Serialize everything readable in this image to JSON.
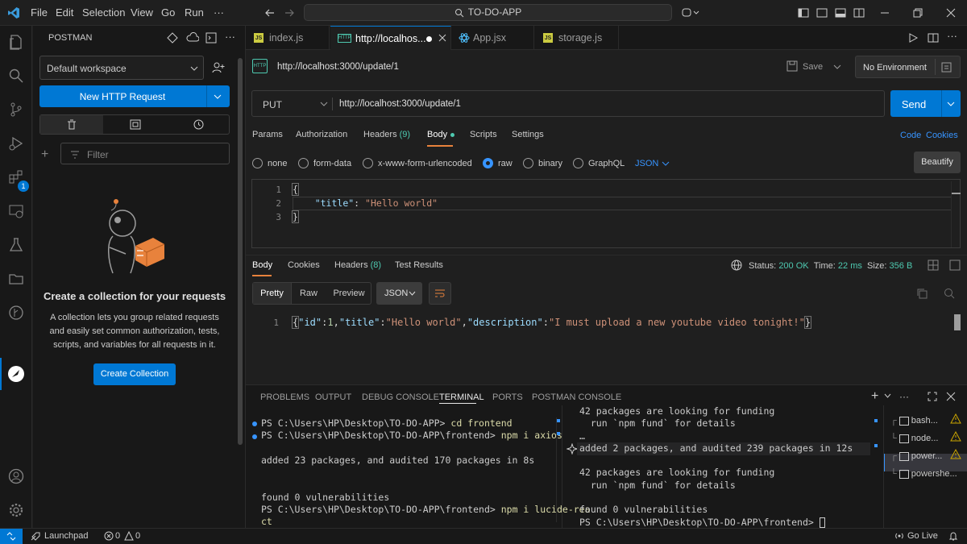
{
  "menu": [
    "File",
    "Edit",
    "Selection",
    "View",
    "Go",
    "Run",
    "···"
  ],
  "search": {
    "label": "TO-DO-APP"
  },
  "sidebar": {
    "title": "POSTMAN",
    "workspace": "Default workspace",
    "new_request": "New HTTP Request",
    "filter_placeholder": "Filter",
    "empty_title": "Create a collection for your requests",
    "empty_desc_1": "A collection lets you group related requests",
    "empty_desc_2": "and easily set common authorization, tests,",
    "empty_desc_3": "scripts, and variables for all requests in it.",
    "create_btn": "Create Collection"
  },
  "tabs": [
    {
      "label": "index.js"
    },
    {
      "label": "http://localhos..."
    },
    {
      "label": "App.jsx"
    },
    {
      "label": "storage.js"
    }
  ],
  "request": {
    "title": "http://localhost:3000/update/1",
    "save": "Save",
    "environment": "No Environment",
    "method": "PUT",
    "url": "http://localhost:3000/update/1",
    "send": "Send",
    "tabs": {
      "params": "Params",
      "authorization": "Authorization",
      "headers": "Headers",
      "headers_count": "(9)",
      "body": "Body",
      "scripts": "Scripts",
      "settings": "Settings"
    },
    "code": "Code",
    "cookies": "Cookies",
    "body_types": {
      "none": "none",
      "form_data": "form-data",
      "urlencoded": "x-www-form-urlencoded",
      "raw": "raw",
      "binary": "binary",
      "graphql": "GraphQL",
      "json": "JSON"
    },
    "beautify": "Beautify",
    "editor": {
      "ln1": "1",
      "ln2": "2",
      "ln3": "3",
      "open": "{",
      "key": "\"title\"",
      "colon": ":",
      "value": "\"Hello world\"",
      "close": "}"
    }
  },
  "response": {
    "tabs": {
      "body": "Body",
      "cookies": "Cookies",
      "headers": "Headers",
      "headers_count": "(8)",
      "test_results": "Test Results"
    },
    "status_label": "Status:",
    "status_value": "200 OK",
    "time_label": "Time:",
    "time_value": "22 ms",
    "size_label": "Size:",
    "size_value": "356 B",
    "views": {
      "pretty": "Pretty",
      "raw": "Raw",
      "preview": "Preview",
      "json": "JSON"
    },
    "ln1": "1",
    "body": {
      "p1": "{",
      "k1": "\"id\"",
      "p2": ":",
      "v1": "1",
      "p3": ",",
      "k2": "\"title\"",
      "p4": ":",
      "v2": "\"Hello world\"",
      "p5": ",",
      "k3": "\"description\"",
      "p6": ":",
      "v3": "\"I must upload a new youtube video tonight!\"",
      "p7": "}"
    }
  },
  "panel": {
    "tabs": [
      "PROBLEMS",
      "OUTPUT",
      "DEBUG CONSOLE",
      "TERMINAL",
      "PORTS",
      "POSTMAN CONSOLE"
    ],
    "left": {
      "l1_prompt": "PS C:\\Users\\HP\\Desktop\\TO-DO-APP>",
      "l1_cmd": "cd frontend",
      "l2_prompt": "PS C:\\Users\\HP\\Desktop\\TO-DO-APP\\frontend>",
      "l2_cmd": "npm i axios",
      "l3": "added 23 packages, and audited 170 packages in 8s",
      "l4": "found 0 vulnerabilities",
      "l5_prompt": "PS C:\\Users\\HP\\Desktop\\TO-DO-APP\\frontend>",
      "l5_cmd": "npm i lucide-rea",
      "l6": "ct"
    },
    "right": {
      "l1": "42 packages are looking for funding",
      "l2": "  run `npm fund` for details",
      "l3": "…",
      "l4": "added 2 packages, and audited 239 packages in 12s",
      "l5": "42 packages are looking for funding",
      "l6": "  run `npm fund` for details",
      "l7": "found 0 vulnerabilities",
      "l8": "PS C:\\Users\\HP\\Desktop\\TO-DO-APP\\frontend>"
    },
    "terminals": [
      "bash...",
      "node...",
      "power...",
      "powershe..."
    ]
  },
  "status": {
    "launchpad": "Launchpad",
    "errors": "0",
    "warnings": "0",
    "golive": "Go Live"
  },
  "colors": {
    "accent": "#0078d4",
    "send": "#0078d4",
    "json_key": "#9cdcfe",
    "json_string": "#ce9178",
    "json_number": "#b5cea8",
    "status_ok": "#4ec9b0",
    "warning": "#cca700",
    "postman_orange": "#e8823c"
  },
  "icons": {
    "activity": [
      "files-icon",
      "search-icon",
      "source-control-icon",
      "run-debug-icon",
      "extensions-icon",
      "remote-explorer-icon",
      "testing-icon",
      "folder-icon",
      "gitlens-icon",
      "postman-icon",
      "account-icon",
      "settings-gear-icon"
    ]
  }
}
